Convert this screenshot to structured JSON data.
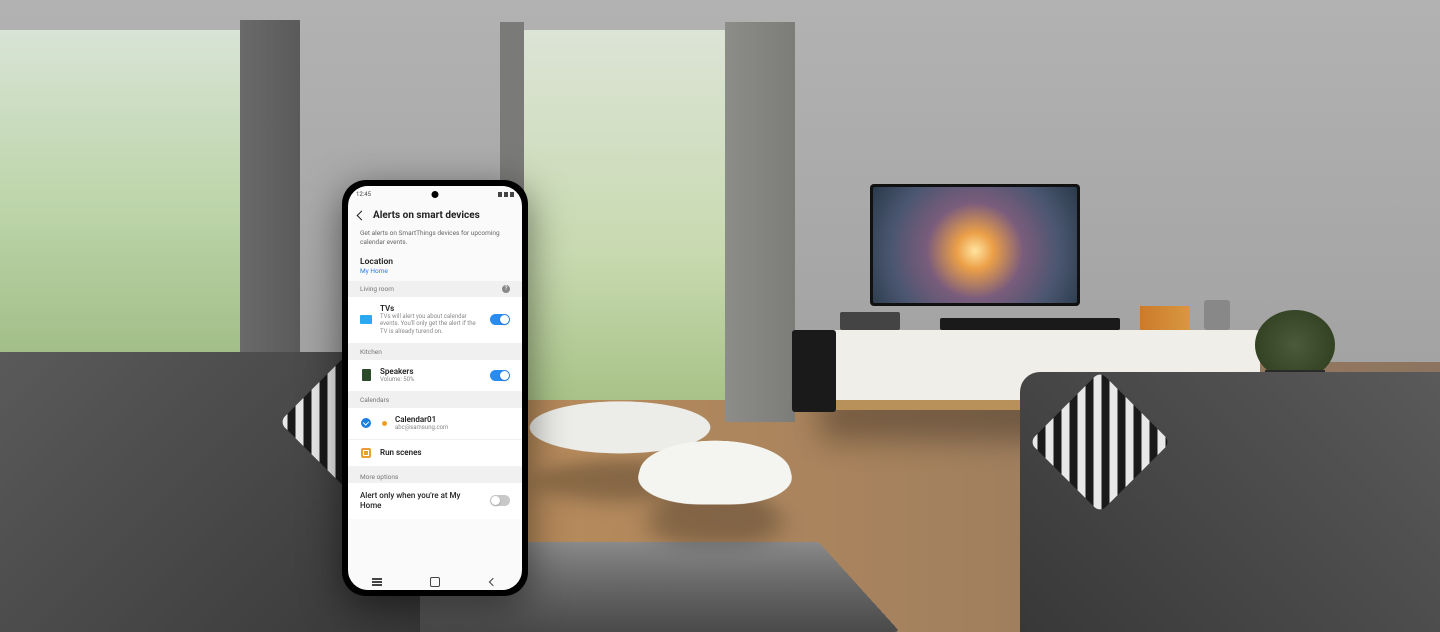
{
  "status": {
    "time": "12:45"
  },
  "header": {
    "title": "Alerts on smart devices"
  },
  "description": "Get alerts on SmartThings devices for upcoming calendar events.",
  "location": {
    "label": "Location",
    "value": "My Home"
  },
  "sections": {
    "living_room": {
      "label": "Living room",
      "tv": {
        "title": "TVs",
        "sub": "TVs will alert you about calendar events. You'll only get the alert if the TV is already turend on.",
        "on": true
      }
    },
    "kitchen": {
      "label": "Kitchen",
      "speakers": {
        "title": "Speakers",
        "sub": "Volume: 50%",
        "on": true
      }
    },
    "calendars": {
      "label": "Calendars",
      "cal": {
        "title": "Calendar01",
        "sub": "abc@samsung.com"
      }
    },
    "run_scenes": {
      "title": "Run scenes"
    }
  },
  "more": {
    "label": "More options",
    "alert_only": "Alert only when you're at My Home",
    "on": false
  }
}
